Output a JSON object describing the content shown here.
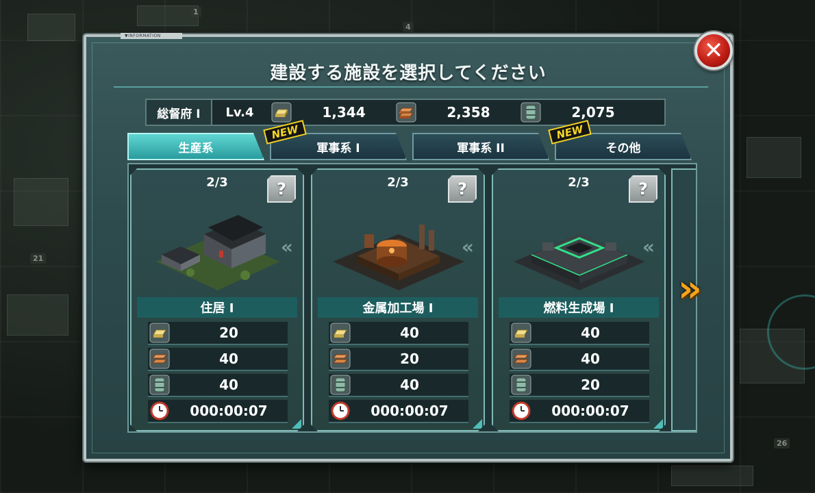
{
  "dialog": {
    "title": "建設する施設を選択してください",
    "info_tab": "▼INFORMATION",
    "close_label": "✕"
  },
  "resources": {
    "hq_label": "総督府 I",
    "hq_level": "Lv.4",
    "items": [
      {
        "icon": "gold-bar-icon",
        "value": "1,344"
      },
      {
        "icon": "metal-ingot-icon",
        "value": "2,358"
      },
      {
        "icon": "fuel-barrel-icon",
        "value": "2,075"
      }
    ]
  },
  "tabs": [
    {
      "label": "生産系",
      "active": true,
      "new": false
    },
    {
      "label": "軍事系 I",
      "active": false,
      "new": true
    },
    {
      "label": "軍事系 II",
      "active": false,
      "new": false
    },
    {
      "label": "その他",
      "active": false,
      "new": true
    }
  ],
  "new_badge": "NEW",
  "cards": [
    {
      "count": "2/3",
      "help": "?",
      "name": "住居 I",
      "costs": {
        "gold": "20",
        "metal": "40",
        "fuel": "40"
      },
      "time": "000:00:07"
    },
    {
      "count": "2/3",
      "help": "?",
      "name": "金属加工場 I",
      "costs": {
        "gold": "40",
        "metal": "20",
        "fuel": "40"
      },
      "time": "000:00:07"
    },
    {
      "count": "2/3",
      "help": "?",
      "name": "燃料生成場 I",
      "costs": {
        "gold": "40",
        "metal": "40",
        "fuel": "20"
      },
      "time": "000:00:07"
    }
  ],
  "background": {
    "numbers": [
      "1",
      "4",
      "21",
      "26"
    ]
  },
  "colors": {
    "accent": "#5fd7d3",
    "close": "#c01d15",
    "new_badge": "#f5d626",
    "next_arrow": "#f5a21b"
  }
}
